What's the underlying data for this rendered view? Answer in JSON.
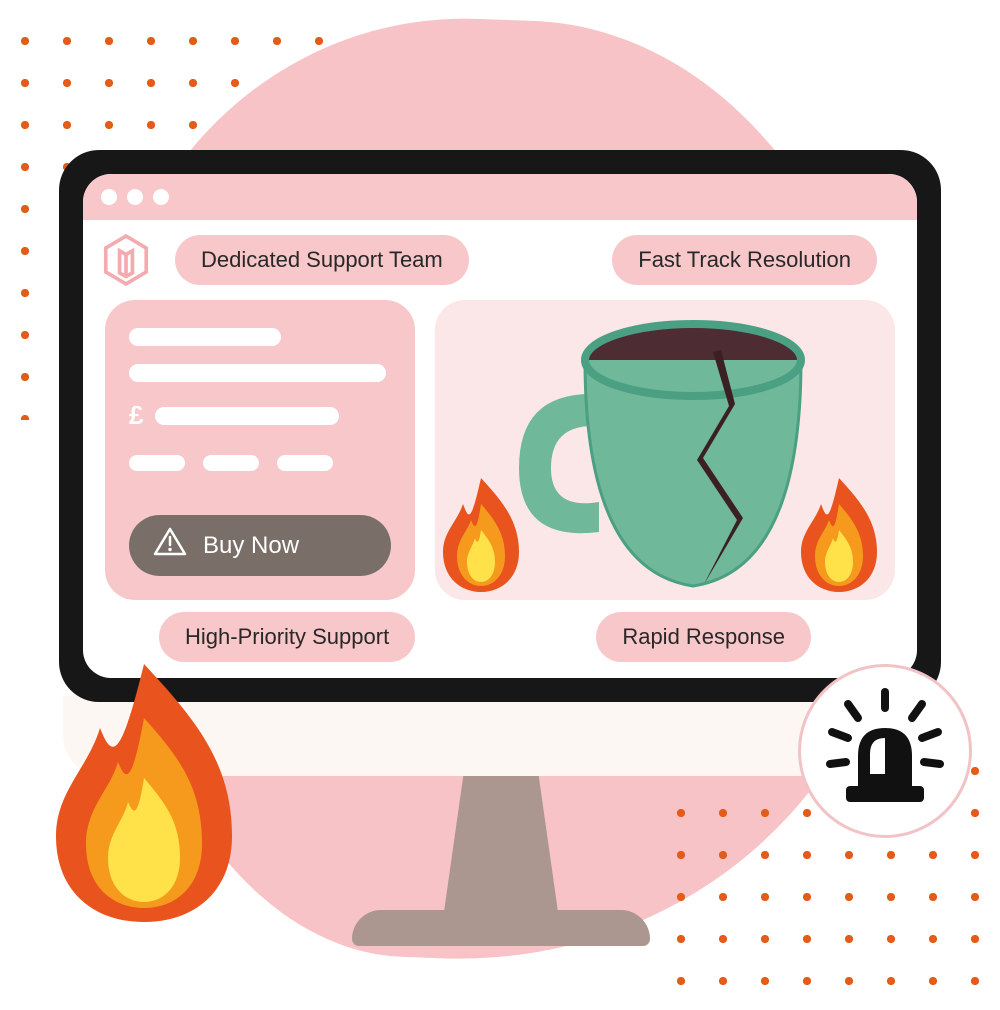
{
  "colors": {
    "pink_blob": "#F8C3C7",
    "pink_pill": "#F7C7CA",
    "pink_panel": "#FCE7E8",
    "monitor_black": "#171717",
    "stand": "#ab9790",
    "buy_button": "#7a6e69",
    "orange_dot": "#e35c1a"
  },
  "header": {
    "logo_name": "magento-logo"
  },
  "pills": {
    "dedicated": "Dedicated Support Team",
    "fast_track": "Fast Track Resolution",
    "high_priority": "High-Priority Support",
    "rapid": "Rapid Response"
  },
  "form": {
    "currency_symbol": "£",
    "buy_label": "Buy Now"
  },
  "icons": {
    "warning": "warning-triangle-icon",
    "alarm": "emergency-alarm-icon",
    "fire": "fire-icon",
    "mug": "broken-mug-icon"
  }
}
